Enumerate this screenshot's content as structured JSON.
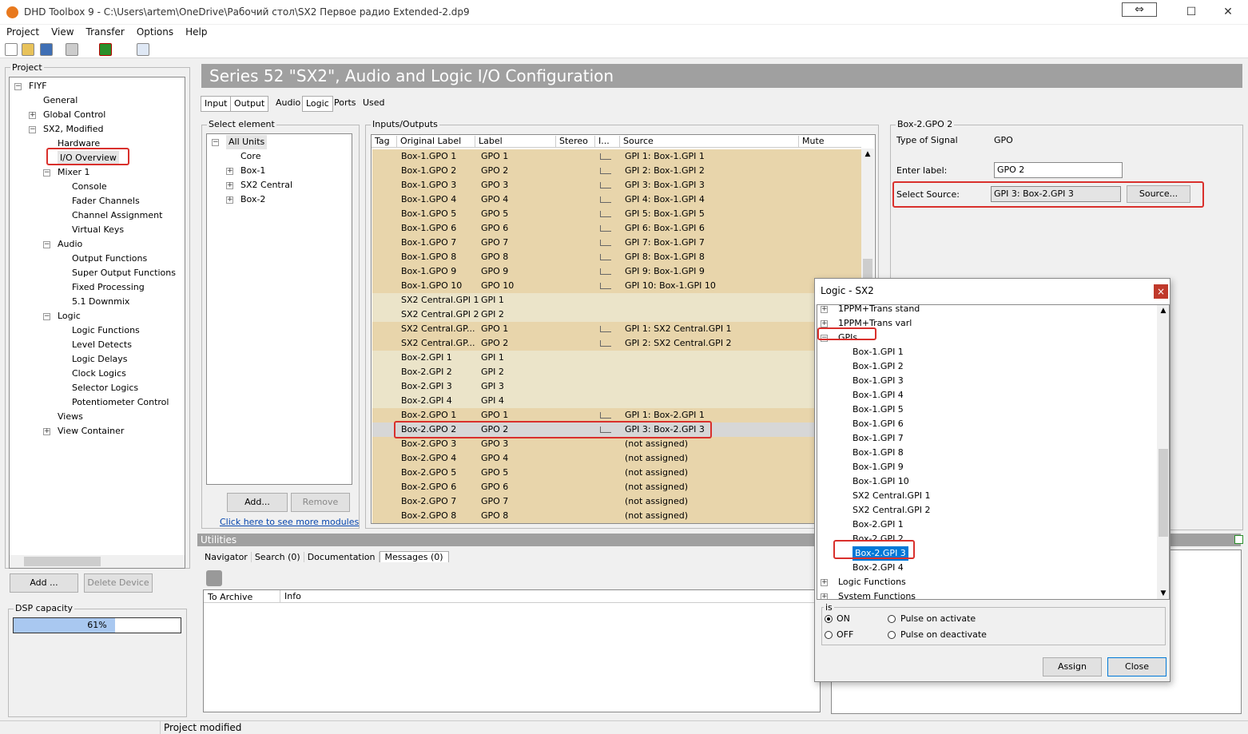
{
  "window": {
    "title": "DHD Toolbox 9 - C:\\Users\\artem\\OneDrive\\Рабочий стол\\SX2 Первое радио Extended-2.dp9",
    "restore_glyph": "⇔",
    "maximize_glyph": "☐",
    "close_glyph": "✕"
  },
  "menu": [
    "Project",
    "View",
    "Transfer",
    "Options",
    "Help"
  ],
  "project": {
    "label": "Project",
    "tree": [
      {
        "text": "FIYF",
        "indent": 0,
        "pm": "−"
      },
      {
        "text": "General",
        "indent": 1
      },
      {
        "text": "Global Control",
        "indent": 1,
        "pm": "+"
      },
      {
        "text": "SX2, Modified",
        "indent": 1,
        "pm": "−"
      },
      {
        "text": "Hardware",
        "indent": 2
      },
      {
        "text": "I/O Overview",
        "indent": 2,
        "selected": true
      },
      {
        "text": "Mixer 1",
        "indent": 2,
        "pm": "−"
      },
      {
        "text": "Console",
        "indent": 3
      },
      {
        "text": "Fader Channels",
        "indent": 3
      },
      {
        "text": "Channel Assignment",
        "indent": 3
      },
      {
        "text": "Virtual Keys",
        "indent": 3
      },
      {
        "text": "Audio",
        "indent": 2,
        "pm": "−"
      },
      {
        "text": "Output Functions",
        "indent": 3
      },
      {
        "text": "Super Output Functions",
        "indent": 3
      },
      {
        "text": "Fixed Processing",
        "indent": 3
      },
      {
        "text": "5.1 Downmix",
        "indent": 3
      },
      {
        "text": "Logic",
        "indent": 2,
        "pm": "−"
      },
      {
        "text": "Logic Functions",
        "indent": 3
      },
      {
        "text": "Level Detects",
        "indent": 3
      },
      {
        "text": "Logic Delays",
        "indent": 3
      },
      {
        "text": "Clock Logics",
        "indent": 3
      },
      {
        "text": "Selector Logics",
        "indent": 3
      },
      {
        "text": "Potentiometer Control",
        "indent": 3
      },
      {
        "text": "Views",
        "indent": 2
      },
      {
        "text": "View Container",
        "indent": 2,
        "pm": "+"
      }
    ],
    "add_button": "Add ...",
    "delete_button": "Delete Device",
    "dsp_label": "DSP capacity",
    "dsp_value": "61%",
    "dsp_fraction": 0.61
  },
  "header": "Series 52 \"SX2\", Audio and Logic I/O  Configuration",
  "tabs": [
    "Input",
    "Output",
    "Audio",
    "Logic",
    "Ports",
    "Used"
  ],
  "select_element": {
    "label": "Select element",
    "tree": [
      {
        "text": "All Units",
        "indent": 0,
        "pm": "−",
        "selected": true
      },
      {
        "text": "Core",
        "indent": 1
      },
      {
        "text": "Box-1",
        "indent": 1,
        "pm": "+"
      },
      {
        "text": "SX2 Central",
        "indent": 1,
        "pm": "+"
      },
      {
        "text": "Box-2",
        "indent": 1,
        "pm": "+"
      }
    ],
    "add_button": "Add...",
    "remove_button": "Remove",
    "link": "Click here to see more modules"
  },
  "io": {
    "label": "Inputs/Outputs",
    "columns": [
      "Tag",
      "Original Label",
      "Label",
      "Stereo",
      "I...",
      "Source",
      "Mute"
    ],
    "rows": [
      {
        "orig": "Box-1.GPO 1",
        "label": "GPO 1",
        "src": "GPI 1: Box-1.GPI 1",
        "kind": "out",
        "icon": true
      },
      {
        "orig": "Box-1.GPO 2",
        "label": "GPO 2",
        "src": "GPI 2: Box-1.GPI 2",
        "kind": "out",
        "icon": true
      },
      {
        "orig": "Box-1.GPO 3",
        "label": "GPO 3",
        "src": "GPI 3: Box-1.GPI 3",
        "kind": "out",
        "icon": true
      },
      {
        "orig": "Box-1.GPO 4",
        "label": "GPO 4",
        "src": "GPI 4: Box-1.GPI 4",
        "kind": "out",
        "icon": true
      },
      {
        "orig": "Box-1.GPO 5",
        "label": "GPO 5",
        "src": "GPI 5: Box-1.GPI 5",
        "kind": "out",
        "icon": true
      },
      {
        "orig": "Box-1.GPO 6",
        "label": "GPO 6",
        "src": "GPI 6: Box-1.GPI 6",
        "kind": "out",
        "icon": true
      },
      {
        "orig": "Box-1.GPO 7",
        "label": "GPO 7",
        "src": "GPI 7: Box-1.GPI 7",
        "kind": "out",
        "icon": true
      },
      {
        "orig": "Box-1.GPO 8",
        "label": "GPO 8",
        "src": "GPI 8: Box-1.GPI 8",
        "kind": "out",
        "icon": true
      },
      {
        "orig": "Box-1.GPO 9",
        "label": "GPO 9",
        "src": "GPI 9: Box-1.GPI 9",
        "kind": "out",
        "icon": true
      },
      {
        "orig": "Box-1.GPO 10",
        "label": "GPO 10",
        "src": "GPI 10: Box-1.GPI 10",
        "kind": "out",
        "icon": true
      },
      {
        "orig": "SX2 Central.GPI 1",
        "label": "GPI 1",
        "src": "",
        "kind": "in",
        "icon": false
      },
      {
        "orig": "SX2 Central.GPI 2",
        "label": "GPI 2",
        "src": "",
        "kind": "in",
        "icon": false
      },
      {
        "orig": "SX2 Central.GP...",
        "label": "GPO 1",
        "src": "GPI 1: SX2 Central.GPI 1",
        "kind": "out",
        "icon": true
      },
      {
        "orig": "SX2 Central.GP...",
        "label": "GPO 2",
        "src": "GPI 2: SX2 Central.GPI 2",
        "kind": "out",
        "icon": true
      },
      {
        "orig": "Box-2.GPI 1",
        "label": "GPI 1",
        "src": "",
        "kind": "in",
        "icon": false
      },
      {
        "orig": "Box-2.GPI 2",
        "label": "GPI 2",
        "src": "",
        "kind": "in",
        "icon": false
      },
      {
        "orig": "Box-2.GPI 3",
        "label": "GPI 3",
        "src": "",
        "kind": "in",
        "icon": false
      },
      {
        "orig": "Box-2.GPI 4",
        "label": "GPI 4",
        "src": "",
        "kind": "in",
        "icon": false
      },
      {
        "orig": "Box-2.GPO 1",
        "label": "GPO 1",
        "src": "GPI 1: Box-2.GPI 1",
        "kind": "out",
        "icon": true
      },
      {
        "orig": "Box-2.GPO 2",
        "label": "GPO 2",
        "src": "GPI 3: Box-2.GPI 3",
        "kind": "sel",
        "icon": true
      },
      {
        "orig": "Box-2.GPO 3",
        "label": "GPO 3",
        "src": "(not assigned)",
        "kind": "out",
        "icon": false
      },
      {
        "orig": "Box-2.GPO 4",
        "label": "GPO 4",
        "src": "(not assigned)",
        "kind": "out",
        "icon": false
      },
      {
        "orig": "Box-2.GPO 5",
        "label": "GPO 5",
        "src": "(not assigned)",
        "kind": "out",
        "icon": false
      },
      {
        "orig": "Box-2.GPO 6",
        "label": "GPO 6",
        "src": "(not assigned)",
        "kind": "out",
        "icon": false
      },
      {
        "orig": "Box-2.GPO 7",
        "label": "GPO 7",
        "src": "(not assigned)",
        "kind": "out",
        "icon": false
      },
      {
        "orig": "Box-2.GPO 8",
        "label": "GPO 8",
        "src": "(not assigned)",
        "kind": "out",
        "icon": false
      }
    ]
  },
  "details": {
    "group_label": "Box-2.GPO 2",
    "type_label": "Type of Signal",
    "type_value": "GPO",
    "enter_label": "Enter label:",
    "label_value": "GPO 2",
    "select_source_label": "Select Source:",
    "source_value": "GPI 3: Box-2.GPI 3",
    "source_button": "Source..."
  },
  "utilities": {
    "title": "Utilities",
    "tabs": [
      "Navigator",
      "Search (0)",
      "Documentation",
      "Messages (0)"
    ],
    "columns": [
      "To Archive",
      "Info"
    ]
  },
  "dialog": {
    "title": "Logic - SX2",
    "close_glyph": "×",
    "tree": [
      {
        "text": "1PPM+Trans stand",
        "indent": 0,
        "pm": "+"
      },
      {
        "text": "1PPM+Trans varl",
        "indent": 0,
        "pm": "+"
      },
      {
        "text": "GPIs",
        "indent": 0,
        "pm": "−"
      },
      {
        "text": "Box-1.GPI 1",
        "indent": 1
      },
      {
        "text": "Box-1.GPI 2",
        "indent": 1
      },
      {
        "text": "Box-1.GPI 3",
        "indent": 1
      },
      {
        "text": "Box-1.GPI 4",
        "indent": 1
      },
      {
        "text": "Box-1.GPI 5",
        "indent": 1
      },
      {
        "text": "Box-1.GPI 6",
        "indent": 1
      },
      {
        "text": "Box-1.GPI 7",
        "indent": 1
      },
      {
        "text": "Box-1.GPI 8",
        "indent": 1
      },
      {
        "text": "Box-1.GPI 9",
        "indent": 1
      },
      {
        "text": "Box-1.GPI 10",
        "indent": 1
      },
      {
        "text": "SX2 Central.GPI 1",
        "indent": 1
      },
      {
        "text": "SX2 Central.GPI 2",
        "indent": 1
      },
      {
        "text": "Box-2.GPI 1",
        "indent": 1
      },
      {
        "text": "Box-2.GPI 2",
        "indent": 1
      },
      {
        "text": "Box-2.GPI 3",
        "indent": 1,
        "selected": true
      },
      {
        "text": "Box-2.GPI 4",
        "indent": 1
      },
      {
        "text": "Logic Functions",
        "indent": 0,
        "pm": "+"
      },
      {
        "text": "System Functions",
        "indent": 0,
        "pm": "+"
      }
    ],
    "is_label": "is",
    "on_label": "ON",
    "off_label": "OFF",
    "pulse_activate": "Pulse on activate",
    "pulse_deactivate": "Pulse on deactivate",
    "assign_button": "Assign",
    "close_button": "Close"
  },
  "status": {
    "text": "Project modified"
  },
  "colors": {
    "out_row": "#e8d5ab",
    "in_row": "#ebe4c9",
    "sel_row": "#d7d7d7",
    "highlight": "#d9302c",
    "selected_item": "#0078d7"
  }
}
